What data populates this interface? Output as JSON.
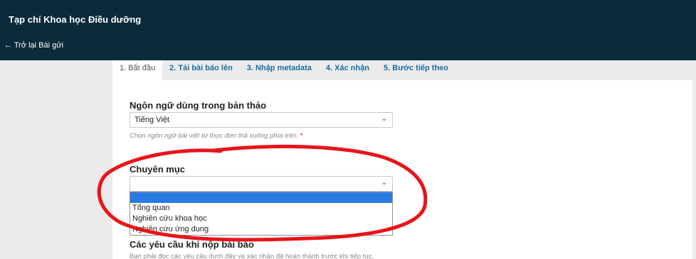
{
  "header": {
    "journal_title": "Tạp chí Khoa học Điều dưỡng",
    "back_link": "← Trở lại Bài gửi"
  },
  "tabs": [
    {
      "label": "1. Bắt đầu",
      "active": true
    },
    {
      "label": "2. Tải bài báo lên",
      "active": false
    },
    {
      "label": "3. Nhập metadata",
      "active": false
    },
    {
      "label": "4. Xác nhận",
      "active": false
    },
    {
      "label": "5. Bước tiếp theo",
      "active": false
    }
  ],
  "form": {
    "language_label": "Ngôn ngữ dùng trong bản thảo",
    "language_value": "Tiếng Việt",
    "language_hint": "Chọn ngôn ngữ bài viết từ thực đơn thả xuống phía trên.",
    "required_mark": "*",
    "section_label": "Chuyên mục",
    "section_value": "",
    "section_options": [
      "",
      "Tổng quan",
      "Nghiên cứu khoa học",
      "Nghiên cứu ứng dụng"
    ],
    "requirements_label": "Các yêu cầu khi nộp bài báo",
    "requirements_hint": "Bạn phải đọc các yêu cầu dưới đây và xác nhận đã hoàn thành trước khi tiếp tục."
  },
  "colors": {
    "header_bg": "#0b2a3a",
    "tab_link": "#1a6ea3",
    "selected_option": "#2a7ae2",
    "annotation": "#e8141a"
  },
  "icons": {
    "select_chevron": "chevron-down-icon"
  }
}
